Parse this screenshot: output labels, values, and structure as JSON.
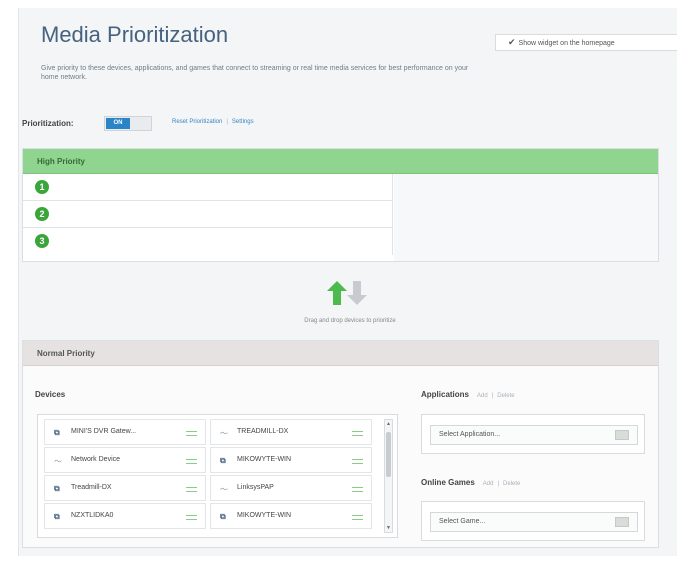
{
  "header": {
    "title": "Media Prioritization",
    "description": "Give priority to these devices, applications, and games that connect to streaming or real time media services for best performance on your home network.",
    "widget_button": "Show widget on the homepage"
  },
  "prioritization": {
    "label": "Prioritization:",
    "toggle_on": "ON",
    "reset_link": "Reset Prioritization",
    "settings_link": "Settings"
  },
  "high_priority": {
    "title": "High Priority",
    "slots": [
      "1",
      "2",
      "3"
    ]
  },
  "drag_hint": "Drag and drop devices to prioritize",
  "normal_priority": {
    "title": "Normal Priority",
    "devices_label": "Devices",
    "devices": [
      {
        "name": "MINI'S DVR Gatew...",
        "icon": "wired-icon"
      },
      {
        "name": "TREADMILL-DX",
        "icon": "wireless-icon"
      },
      {
        "name": "Network Device",
        "icon": "wireless-icon"
      },
      {
        "name": "MIKOWYTE-WIN",
        "icon": "wired-icon"
      },
      {
        "name": "Treadmill-DX",
        "icon": "wired-icon"
      },
      {
        "name": "LinksysPAP",
        "icon": "wireless-icon"
      },
      {
        "name": "NZXTLIDKA0",
        "icon": "wired-icon"
      },
      {
        "name": "MIKOWYTE-WIN",
        "icon": "wired-icon"
      }
    ],
    "applications": {
      "label": "Applications",
      "add": "Add",
      "delete": "Delete",
      "select_placeholder": "Select Application..."
    },
    "games": {
      "label": "Online Games",
      "add": "Add",
      "delete": "Delete",
      "select_placeholder": "Select Game..."
    }
  },
  "colors": {
    "high_header": "#8fd58f",
    "toggle_on": "#2a84c6",
    "title": "#46627f",
    "link": "#3a86c2"
  }
}
